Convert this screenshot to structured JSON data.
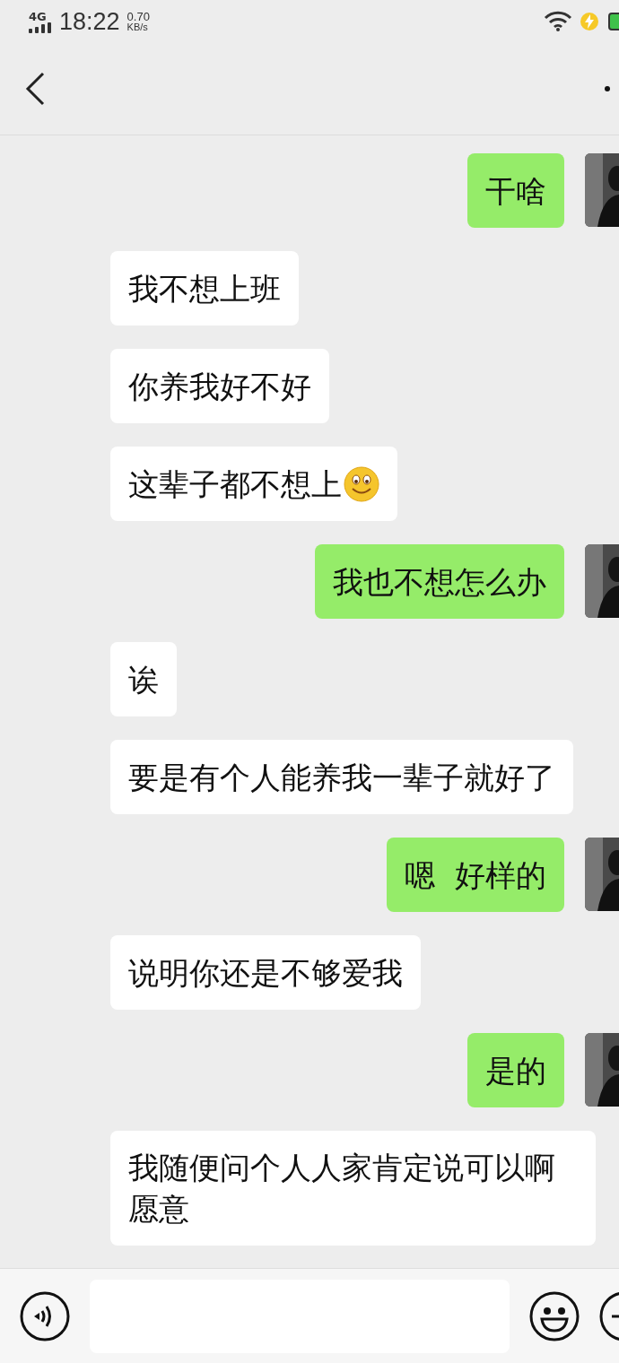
{
  "status_bar": {
    "network": "4G",
    "time": "18:22",
    "speed_value": "0.70",
    "speed_unit": "KB/s"
  },
  "messages": [
    {
      "kind": "sent",
      "text": "干啥"
    },
    {
      "kind": "received",
      "text": "我不想上班"
    },
    {
      "kind": "received",
      "text": "你养我好不好"
    },
    {
      "kind": "received",
      "text": "这辈子都不想上",
      "emoji": true
    },
    {
      "kind": "sent",
      "text": "我也不想怎么办"
    },
    {
      "kind": "received",
      "text": "诶"
    },
    {
      "kind": "received",
      "text": "要是有个人能养我一辈子就好了"
    },
    {
      "kind": "sent",
      "text": "嗯  好样的"
    },
    {
      "kind": "received",
      "text": "说明你还是不够爱我"
    },
    {
      "kind": "sent",
      "text": "是的"
    },
    {
      "kind": "received",
      "text": "我随便问个人人家肯定说可以啊愿意"
    }
  ]
}
